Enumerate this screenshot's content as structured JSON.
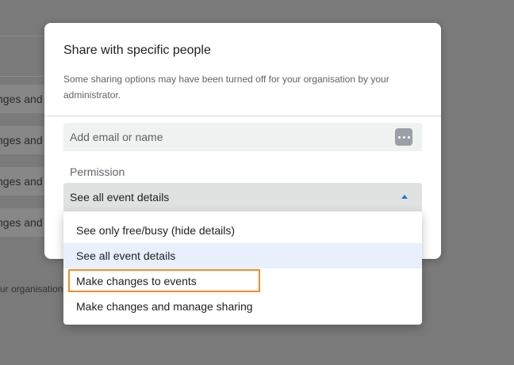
{
  "background": {
    "chips": [
      "nges and",
      "nges and",
      "nges and",
      "nges and"
    ],
    "footer_text": "ur organisation."
  },
  "dialog": {
    "title": "Share with specific people",
    "note": "Some sharing options may have been turned off for your organisation by your administrator.",
    "email_placeholder": "Add email or name",
    "permission_label": "Permission",
    "permission_value": "See all event details"
  },
  "menu": {
    "items": [
      "See only free/busy (hide details)",
      "See all event details",
      "Make changes to events",
      "Make changes and manage sharing"
    ],
    "selected_index": 1,
    "highlighted_index": 2
  },
  "colors": {
    "accent": "#1a73e8",
    "highlight": "#f28c28",
    "selected_bg": "#e8f0fe"
  }
}
